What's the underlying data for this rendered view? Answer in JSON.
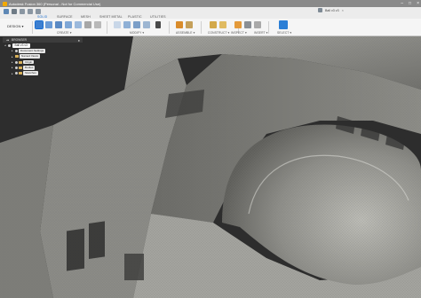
{
  "window": {
    "title": "Autodesk Fusion 360 (Personal - Not for Commercial Use)",
    "controls": [
      "–",
      "□",
      "×"
    ]
  },
  "tabs": [
    "SOLID",
    "SURFACE",
    "MESH",
    "SHEET METAL",
    "PLASTIC",
    "UTILITIES"
  ],
  "active_tab": "SOLID",
  "document_tab": {
    "label": "Ball v3 v3",
    "close": "×"
  },
  "toolbar": {
    "design_label": "DESIGN ▾",
    "groups": [
      "CREATE ▾",
      "MODIFY ▾",
      "ASSEMBLE ▾",
      "CONSTRUCT ▾",
      "INSPECT ▾",
      "INSERT ▾",
      "SELECT ▾"
    ]
  },
  "browser": {
    "title": "BROWSER",
    "root": "Ball v3 v3",
    "items": [
      "Document Settings",
      "Named Views",
      "Origin",
      "Bodies",
      "Sketches"
    ]
  },
  "colors": {
    "accent": "#1a6fd1",
    "viewport_bg": "#2e2e2e",
    "model_surface": "#8f8f8a"
  }
}
